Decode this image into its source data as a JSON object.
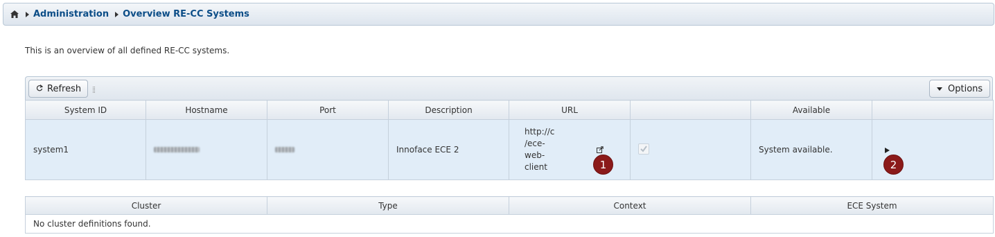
{
  "breadcrumb": {
    "home_icon": "home-icon",
    "items": [
      "Administration",
      "Overview RE-CC Systems"
    ]
  },
  "intro_text": "This is an overview of all defined RE-CC systems.",
  "toolbar": {
    "refresh_label": "Refresh",
    "refresh_icon": "refresh-icon",
    "options_label": "Options",
    "options_icon": "caret-down-icon"
  },
  "systems_table": {
    "columns": [
      "System ID",
      "Hostname",
      "Port",
      "Description",
      "URL",
      "",
      "Available",
      ""
    ],
    "rows": [
      {
        "system_id": "system1",
        "description": "Innoface ECE 2",
        "url": "http://c /ece- web- client",
        "available": "System available.",
        "checked": true
      }
    ]
  },
  "markers": [
    "1",
    "2"
  ],
  "cluster_table": {
    "columns": [
      "Cluster",
      "Type",
      "Context",
      "ECE System"
    ],
    "empty_text": "No cluster definitions found."
  },
  "colors": {
    "link": "#0b4d87",
    "row_selected": "#e1edf8",
    "marker": "#8b1a1a"
  }
}
